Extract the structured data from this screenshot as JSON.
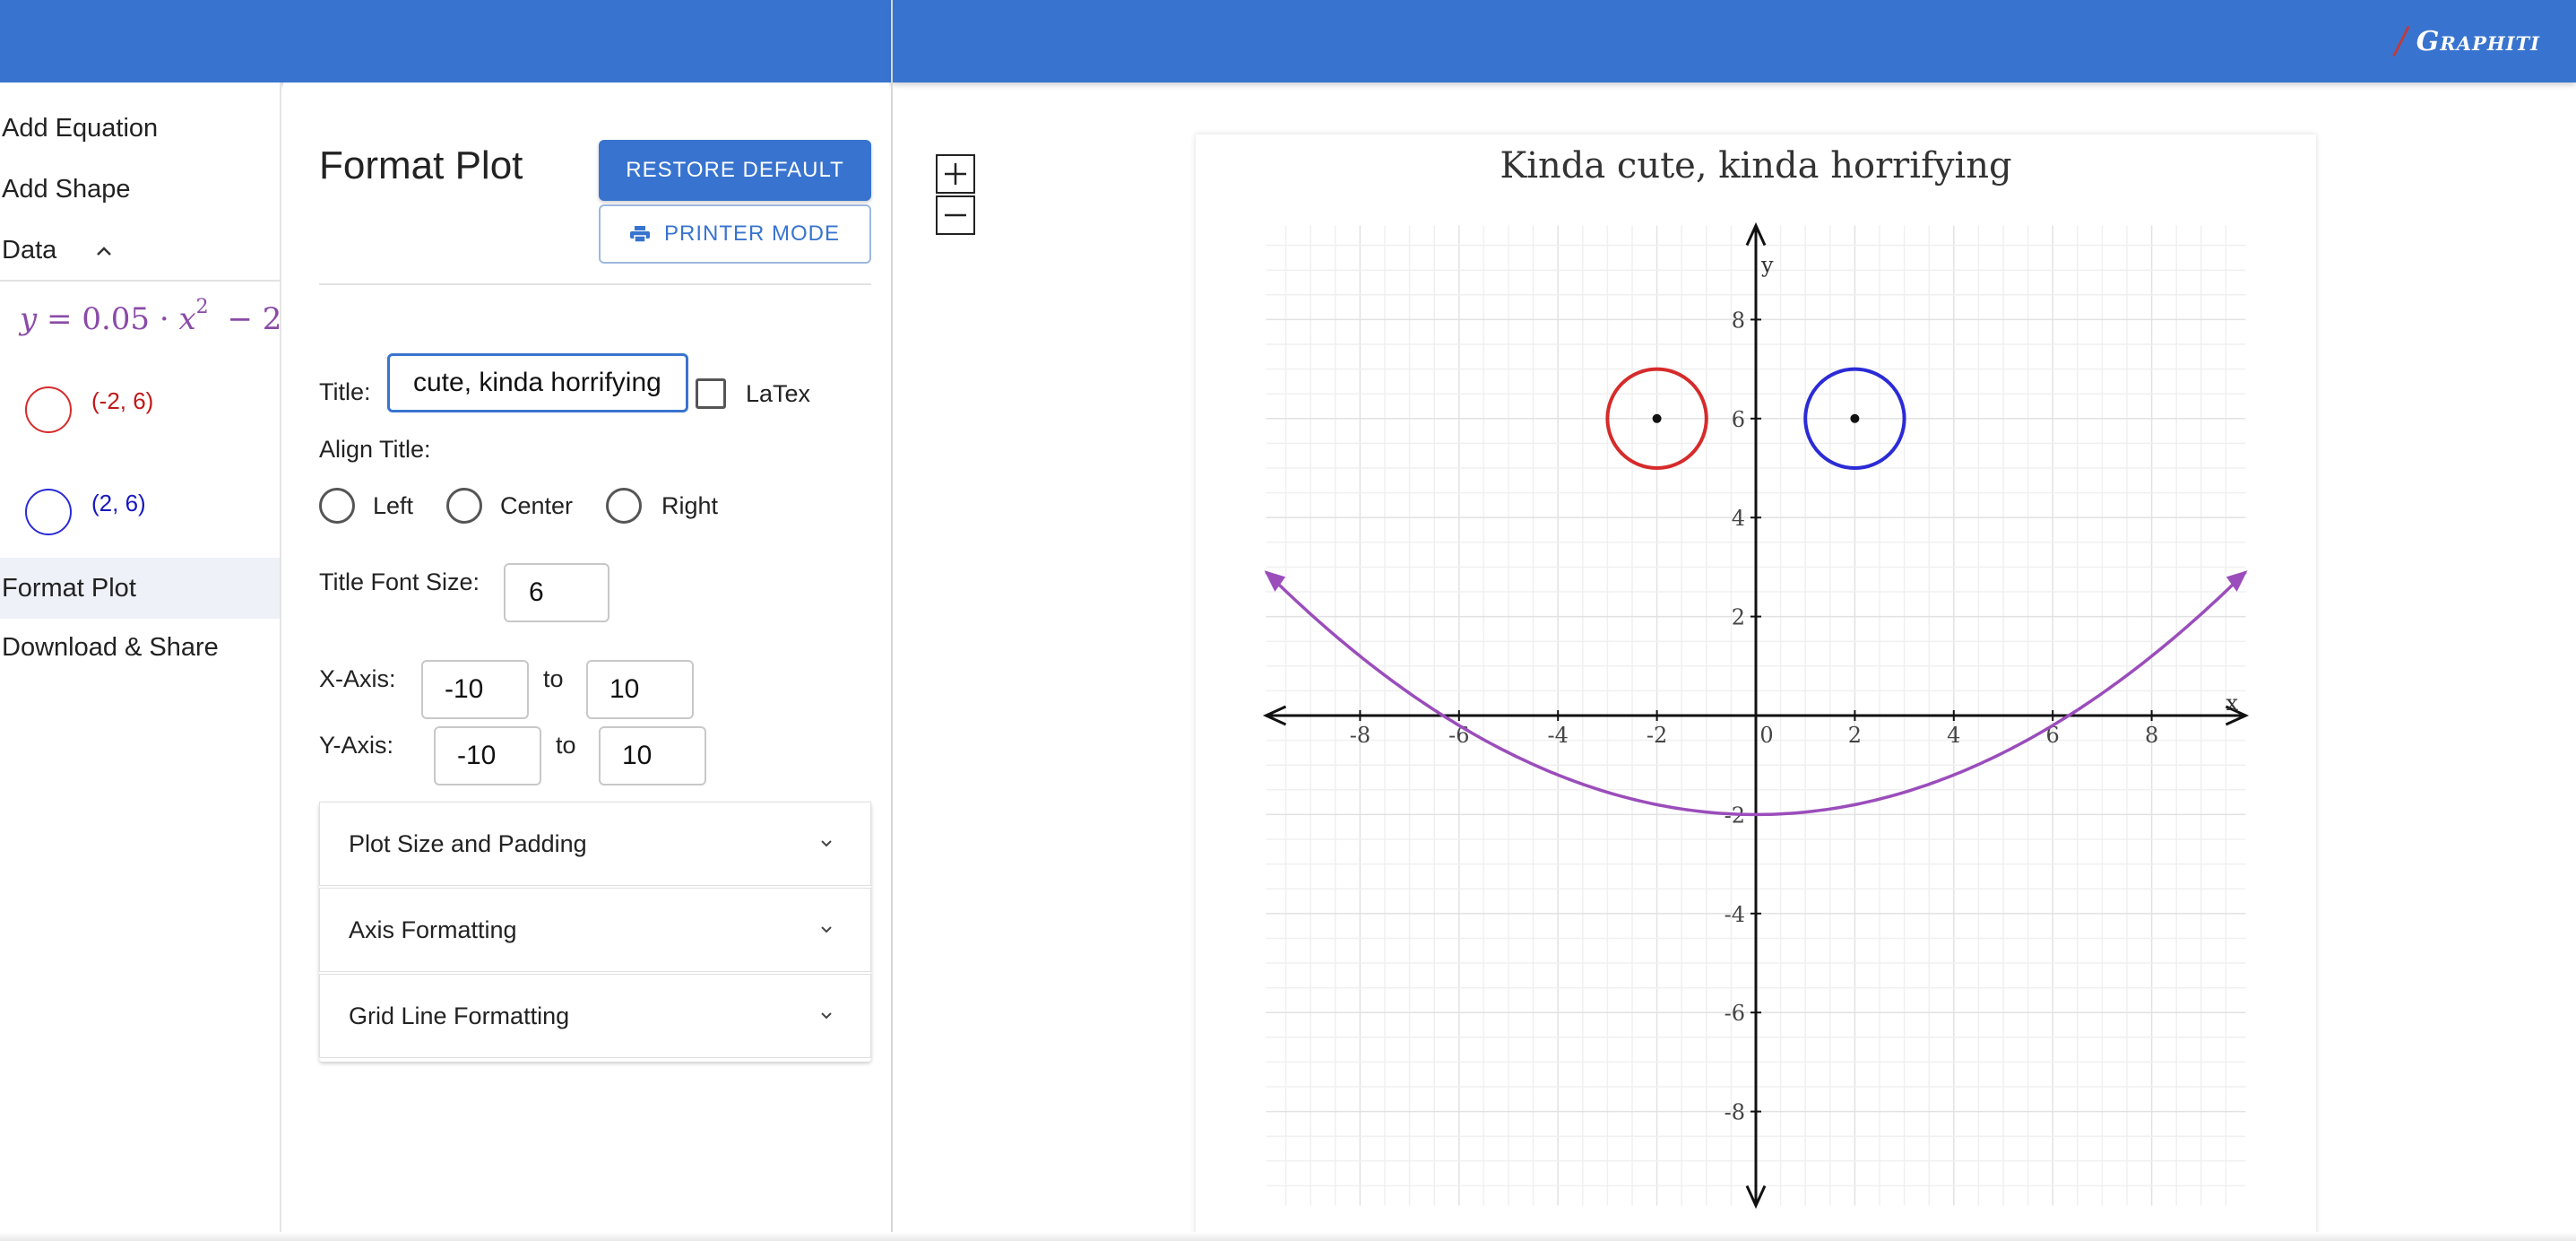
{
  "brand": {
    "name": "Graphiti"
  },
  "nav": {
    "add_equation": "Add Equation",
    "add_shape": "Add Shape",
    "data": "Data",
    "format_plot": "Format Plot",
    "download_share": "Download & Share",
    "equation": {
      "lhs": "y",
      "eq": "=",
      "coef": "0.05",
      "dot": "·",
      "var": "x",
      "exp": "2",
      "rest": "− 2"
    },
    "shapes": [
      {
        "label": "(-2, 6)",
        "color": "#d62b2b"
      },
      {
        "label": "(2, 6)",
        "color": "#2b2bd6"
      }
    ]
  },
  "panel": {
    "title": "Format Plot",
    "restore_default": "RESTORE DEFAULT",
    "printer_mode": "PRINTER MODE",
    "title_label": "Title:",
    "title_value": "cute, kinda horrifying",
    "latex_label": "LaTex",
    "align_title_label": "Align Title:",
    "align_options": [
      "Left",
      "Center",
      "Right"
    ],
    "title_font_size_label": "Title Font Size:",
    "title_font_size": "6",
    "x_axis_label": "X-Axis:",
    "x_min": "-10",
    "x_max": "10",
    "y_axis_label": "Y-Axis:",
    "y_min": "-10",
    "y_max": "10",
    "to": "to",
    "sections": [
      "Plot Size and Padding",
      "Axis Formatting",
      "Grid Line Formatting"
    ]
  },
  "zoom": {
    "in": "+",
    "out": "−"
  },
  "chart_data": {
    "type": "line",
    "title": "Kinda cute, kinda horrifying",
    "xlabel": "x",
    "ylabel": "y",
    "xlim": [
      -10,
      10
    ],
    "ylim": [
      -10,
      10
    ],
    "grid": true,
    "x_ticks": [
      -8,
      -6,
      -4,
      -2,
      0,
      2,
      4,
      6,
      8
    ],
    "y_ticks": [
      -8,
      -6,
      -4,
      -2,
      2,
      4,
      6,
      8
    ],
    "x_tick_labels": [
      "-8",
      "-6",
      "-4",
      "-2",
      "0",
      "2",
      "4",
      "6",
      "8"
    ],
    "y_tick_labels": [
      "-8",
      "-6",
      "-4",
      "-2",
      "2",
      "4",
      "6",
      "8"
    ],
    "curve": {
      "expression": "y = 0.05·x^2 − 2",
      "a": 0.05,
      "c": -2,
      "x_range": [
        -10,
        10
      ],
      "color": "#9b4dbb"
    },
    "shapes": [
      {
        "type": "circle",
        "cx": -2,
        "cy": 6,
        "r": 1,
        "color": "#d62b2b"
      },
      {
        "type": "circle",
        "cx": 2,
        "cy": 6,
        "r": 1,
        "color": "#2b2bd6"
      }
    ]
  }
}
